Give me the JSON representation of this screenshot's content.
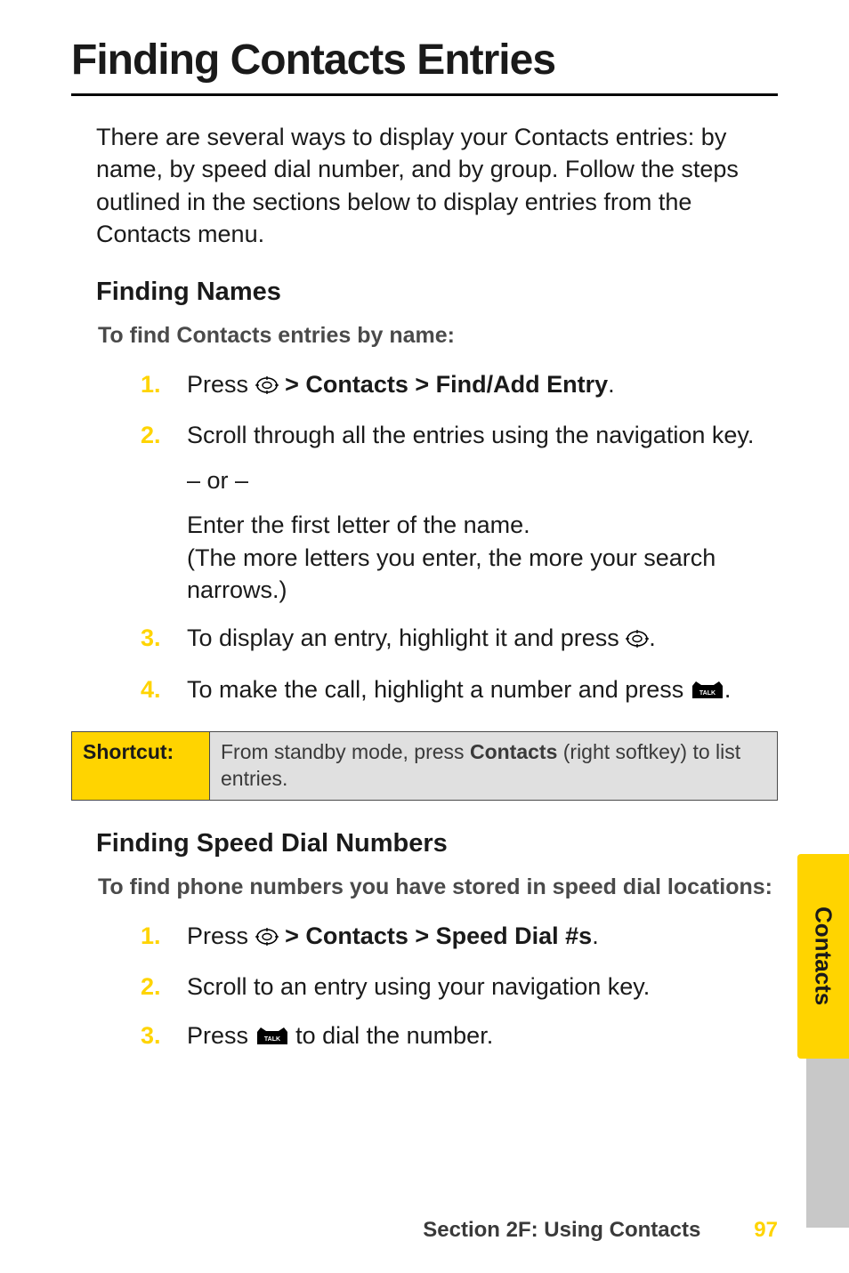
{
  "title": "Finding Contacts Entries",
  "intro": "There are several ways to display your Contacts entries: by name, by speed dial number, and by group. Follow the steps outlined in the sections below to display entries from the Contacts menu.",
  "section1": {
    "heading": "Finding Names",
    "lead": "To find Contacts entries by name:",
    "steps": {
      "s1_prefix": "Press",
      "s1_suffix": " > Contacts > Find/Add Entry",
      "s1_period": ".",
      "s2": "Scroll through all the entries using the navigation key.",
      "s2_or": "– or –",
      "s2_alt1": "Enter the first letter of the name.",
      "s2_alt2": "(The more letters you enter, the more your search narrows.)",
      "s3_prefix": "To display an entry, highlight it and press",
      "s3_suffix": ".",
      "s4_prefix": "To make the call, highlight a number and press",
      "s4_suffix": "."
    }
  },
  "shortcut": {
    "label": "Shortcut:",
    "text_prefix": "From standby mode, press ",
    "text_bold": "Contacts",
    "text_suffix": " (right softkey) to list entries."
  },
  "section2": {
    "heading": "Finding Speed Dial Numbers",
    "lead": "To find phone numbers you have stored in speed dial locations:",
    "steps": {
      "s1_prefix": "Press",
      "s1_suffix": " > Contacts > Speed Dial #s",
      "s1_period": ".",
      "s2": "Scroll to an entry using your navigation key.",
      "s3_prefix": "Press",
      "s3_suffix": " to dial the number."
    }
  },
  "sidetab": "Contacts",
  "footer": {
    "section": "Section 2F: Using Contacts",
    "page": "97"
  }
}
